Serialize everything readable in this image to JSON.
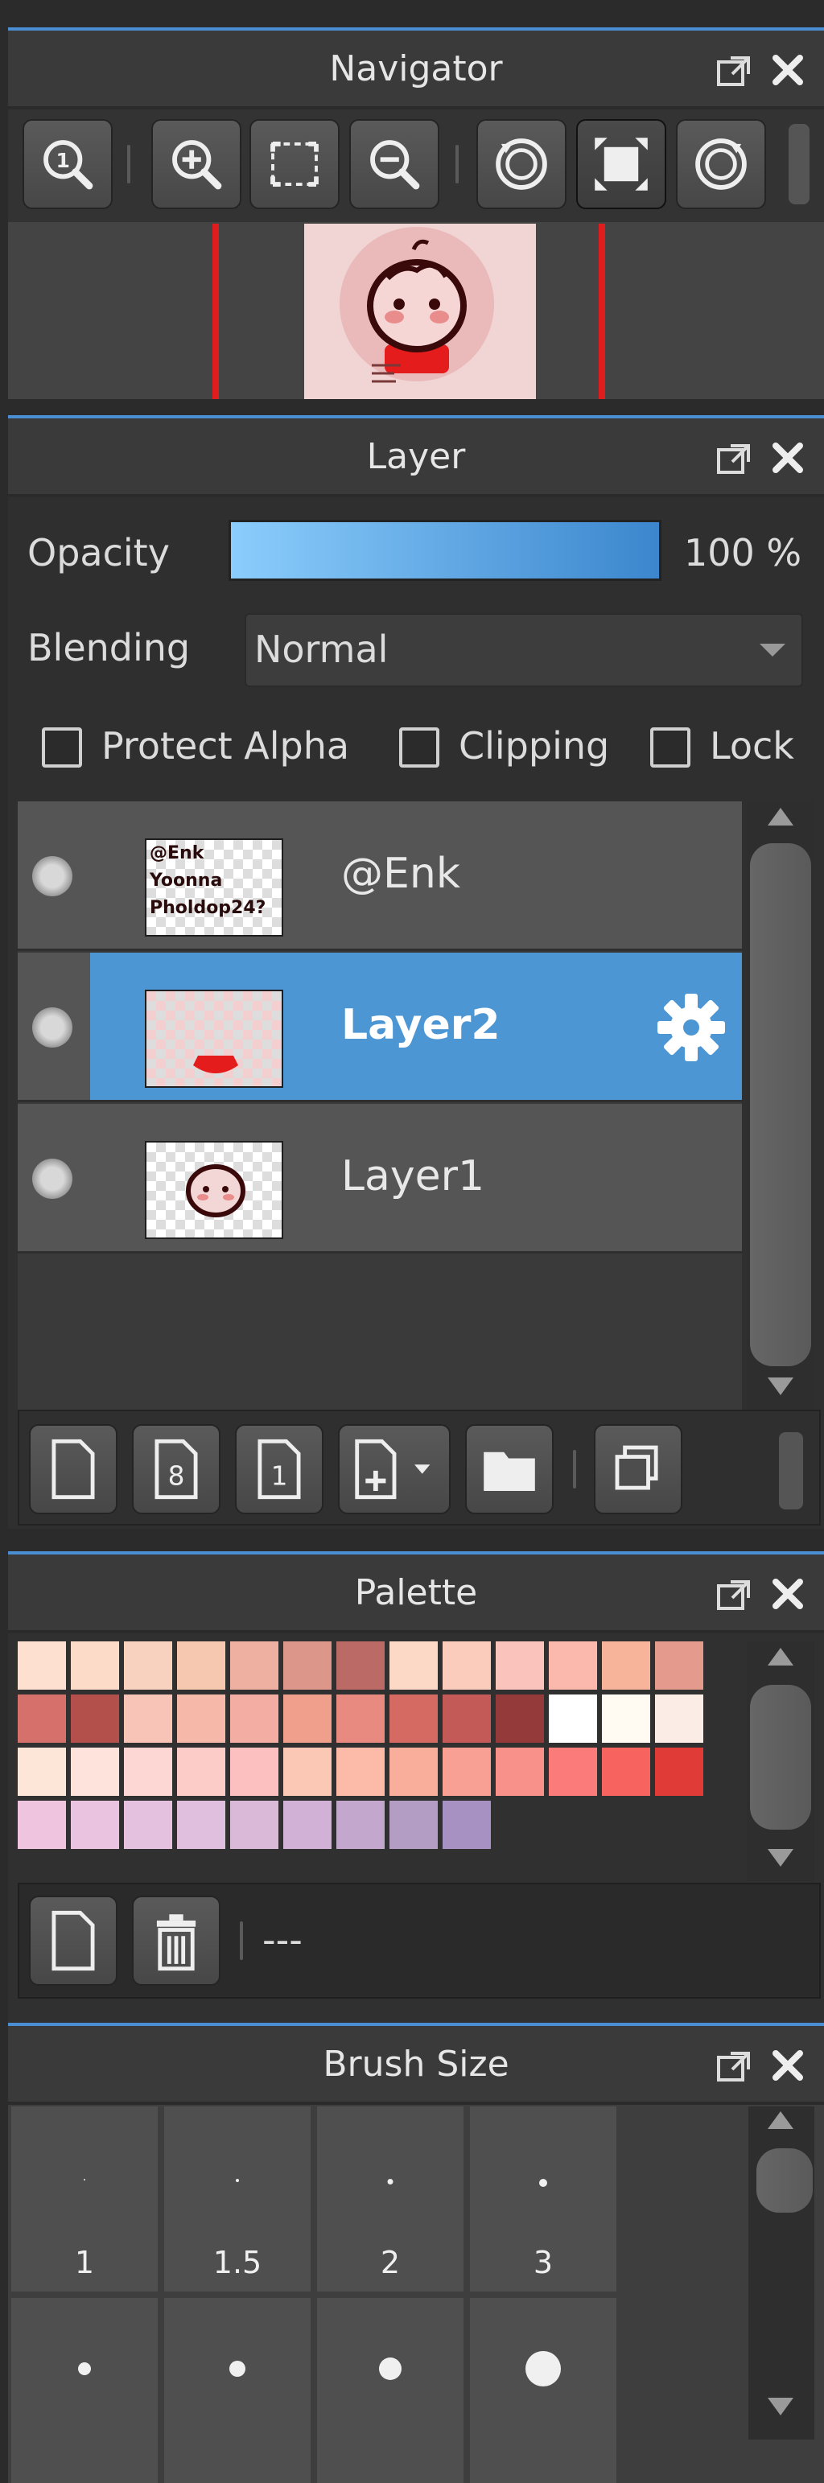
{
  "navigator": {
    "title": "Navigator",
    "buttons": [
      "zoom-actual-icon",
      "zoom-in-icon",
      "fit-window-icon",
      "zoom-out-icon",
      "rotate-left-icon",
      "fullscreen-icon",
      "rotate-right-icon"
    ]
  },
  "layer": {
    "title": "Layer",
    "opacity_label": "Opacity",
    "opacity_value": "100 %",
    "opacity_fraction": 1.0,
    "blending_label": "Blending",
    "blending_value": "Normal",
    "protect_alpha_label": "Protect Alpha",
    "clipping_label": "Clipping",
    "lock_label": "Lock",
    "layers": [
      {
        "name": "@Enk",
        "selected": false
      },
      {
        "name": "Layer2",
        "selected": true
      },
      {
        "name": "Layer1",
        "selected": false
      }
    ],
    "thumb_text": [
      "@Enk",
      "Yoonna",
      "Pholdop24?"
    ]
  },
  "palette": {
    "title": "Palette",
    "name": "---",
    "rows": [
      [
        "#fde0cf",
        "#fcdcc8",
        "#f9d2bf",
        "#f6c8b0",
        "#eeb0a0",
        "#dc968a",
        "#bc6a66",
        "#fcd9c6",
        "#fbcbbc",
        "#fac4bd",
        "#fbb9ae",
        "#f8b49b",
        "#e49b8e"
      ],
      [
        "#d6706a",
        "#b4504b",
        "#f9c4b8",
        "#f6b8a8",
        "#f3ada2",
        "#ef9f8c",
        "#e88a7f",
        "#d56a62",
        "#c45a58",
        "#943a3a",
        "#ffffff",
        "#fffaf2",
        "#fbede5"
      ],
      [
        "#fde5d8",
        "#fee2dc",
        "#fdd7d3",
        "#fcccc9",
        "#fbc0bf",
        "#fcc8b6",
        "#fbbba8",
        "#f9ae9c",
        "#f9a095",
        "#f8918a",
        "#fb7a7a",
        "#f7645f",
        "#e03b36"
      ],
      [
        "#efc4df",
        "#e9c3df",
        "#e4c1de",
        "#dfbfdd",
        "#d9b9d7",
        "#d1b2d6",
        "#c3a7cc",
        "#b39dc4",
        "#a791c2"
      ]
    ]
  },
  "brush_size": {
    "title": "Brush Size",
    "sizes": [
      {
        "label": "1",
        "dot": 2
      },
      {
        "label": "1.5",
        "dot": 4
      },
      {
        "label": "2",
        "dot": 7
      },
      {
        "label": "3",
        "dot": 10
      },
      {
        "label": "",
        "dot": 16
      },
      {
        "label": "",
        "dot": 20
      },
      {
        "label": "",
        "dot": 28
      },
      {
        "label": "",
        "dot": 44
      }
    ]
  },
  "colors": {
    "accent": "#4a8fd4",
    "selection": "#4d96d4",
    "bar_start": "#8bcdfc",
    "bar_end": "#3b86cd"
  }
}
